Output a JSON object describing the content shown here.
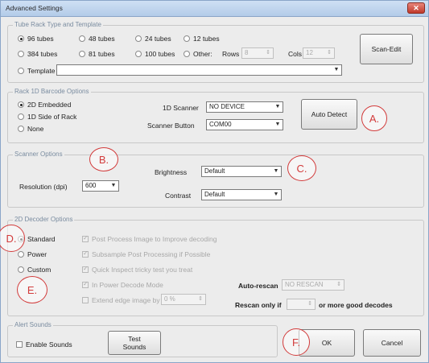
{
  "window": {
    "title": "Advanced Settings",
    "close_glyph": "✕"
  },
  "tube_rack": {
    "legend": "Tube Rack Type and Template",
    "options": [
      "96 tubes",
      "48 tubes",
      "24 tubes",
      "12 tubes",
      "384 tubes",
      "81 tubes",
      "100 tubes",
      "Other:",
      "Template"
    ],
    "selected": "96 tubes",
    "rows_label": "Rows",
    "rows_value": "8",
    "cols_label": "Cols",
    "cols_value": "12",
    "template_value": "",
    "scan_edit_label": "Scan-Edit"
  },
  "barcode": {
    "legend": "Rack 1D Barcode Options",
    "options": [
      "2D Embedded",
      "1D Side of Rack",
      "None"
    ],
    "selected": "2D Embedded",
    "scanner_label": "1D Scanner",
    "scanner_value": "NO DEVICE",
    "scanner_button_label": "Scanner Button",
    "scanner_button_value": "COM00",
    "auto_detect_label": "Auto Detect"
  },
  "scanner_options": {
    "legend": "Scanner Options",
    "brightness_label": "Brightness",
    "brightness_value": "Default",
    "resolution_label": "Resolution (dpi)",
    "resolution_value": "600",
    "contrast_label": "Contrast",
    "contrast_value": "Default"
  },
  "decoder": {
    "legend": "2D Decoder Options",
    "modes": [
      "Standard",
      "Power",
      "Custom"
    ],
    "selected": "Standard",
    "custom_options": [
      "Post Process Image to Improve decoding",
      "Subsample Post Processing if Possible",
      "Quick Inspect tricky test you treat",
      "In Power Decode Mode",
      "Extend edge image by"
    ],
    "extend_value": "0 %",
    "auto_rescan_label": "Auto-rescan",
    "auto_rescan_value": "NO RESCAN",
    "rescan_only_label": "Rescan only if",
    "rescan_only_value": "",
    "rescan_suffix": "or more good decodes"
  },
  "alerts": {
    "legend": "Alert Sounds",
    "enable_label": "Enable Sounds",
    "test_label": "Test Sounds"
  },
  "footer": {
    "ok_label": "OK",
    "cancel_label": "Cancel"
  },
  "annotations": [
    "A.",
    "B.",
    "C.",
    "D.",
    "E.",
    "F."
  ],
  "colors": {
    "annotation": "#d23b3b",
    "legend_text": "#7a8ca0",
    "titlebar": "#b3cbe8"
  }
}
